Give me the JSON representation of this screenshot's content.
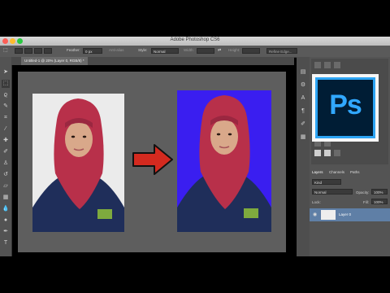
{
  "window": {
    "title": "Adobe Photoshop CS6"
  },
  "options": {
    "feather_label": "Feather:",
    "feather_value": "0 px",
    "antialias_label": "Anti-alias",
    "style_label": "Style:",
    "style_value": "Normal",
    "width_label": "Width:",
    "height_label": "Height:",
    "refine_label": "Refine Edge..."
  },
  "document": {
    "tab_label": "Untitled-1 @ 20% (Layer 0, RGB/8) *"
  },
  "panels": {
    "tabs": [
      "Layers",
      "Channels",
      "Paths"
    ],
    "kind_label": "Kind",
    "blend_mode": "Normal",
    "opacity_label": "Opacity:",
    "opacity_value": "100%",
    "lock_label": "Lock:",
    "fill_label": "Fill:",
    "fill_value": "100%",
    "layer_name": "Layer 0"
  },
  "logo": {
    "text": "Ps"
  },
  "colors": {
    "photo_before_bg": "#ebebeb",
    "photo_after_bg": "#3a1ef0",
    "arrow": "#d42a1f",
    "hijab": "#b8304a",
    "jacket": "#1f2e5a",
    "ps_blue": "#31a8ff",
    "ps_dark": "#001d35"
  }
}
